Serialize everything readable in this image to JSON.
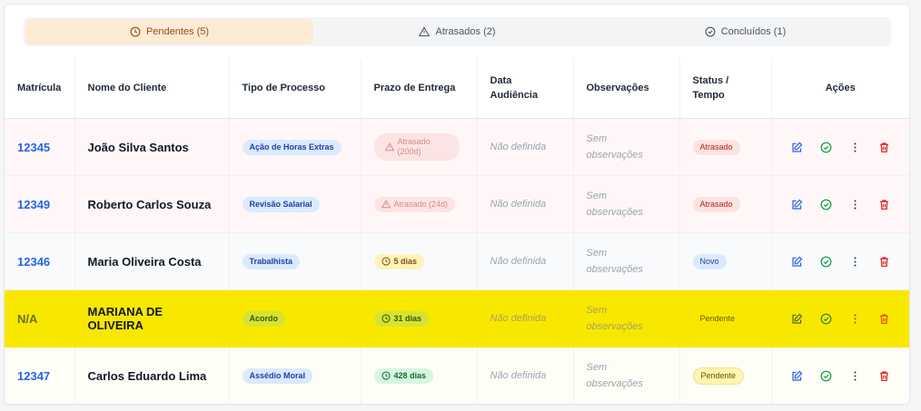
{
  "tabs": [
    {
      "label": "Pendentes (5)",
      "icon": "clock-icon",
      "active": true
    },
    {
      "label": "Atrasados (2)",
      "icon": "warning-icon",
      "active": false
    },
    {
      "label": "Concluídos (1)",
      "icon": "check-circle-icon",
      "active": false
    }
  ],
  "table": {
    "headers": [
      "Matrícula",
      "Nome do Cliente",
      "Tipo de Processo",
      "Prazo de Entrega",
      "Data Audiência",
      "Observações",
      "Status / Tempo",
      "Ações"
    ],
    "rows": [
      {
        "matricula": "12345",
        "nome": "João Silva Santos",
        "tipo": "Ação de Horas Extras",
        "prazo": "Atrasado (200d)",
        "audiencia": "Não definida",
        "obs": "Sem observações",
        "status": "Atrasado"
      },
      {
        "matricula": "12349",
        "nome": "Roberto Carlos Souza",
        "tipo": "Revisão Salarial",
        "prazo": "Atrasado (24d)",
        "audiencia": "Não definida",
        "obs": "Sem observações",
        "status": "Atrasado"
      },
      {
        "matricula": "12346",
        "nome": "Maria Oliveira Costa",
        "tipo": "Trabalhista",
        "prazo": "5 dias",
        "audiencia": "Não definida",
        "obs": "Sem observações",
        "status": "Novo"
      },
      {
        "matricula": "N/A",
        "nome": "MARIANA DE OLIVEIRA",
        "tipo": "Acordo",
        "prazo": "31 dias",
        "audiencia": "Não definida",
        "obs": "Sem observações",
        "status": "Pendente"
      },
      {
        "matricula": "12347",
        "nome": "Carlos Eduardo Lima",
        "tipo": "Assédio Moral",
        "prazo": "428 dias",
        "audiencia": "Não definida",
        "obs": "Sem observações",
        "status": "Pendente"
      }
    ]
  },
  "colors": {
    "accent_tab": "#fdebd6",
    "link_blue": "#2563eb",
    "highlight": "#f8e800",
    "danger": "#dc2626",
    "success": "#16a34a"
  }
}
